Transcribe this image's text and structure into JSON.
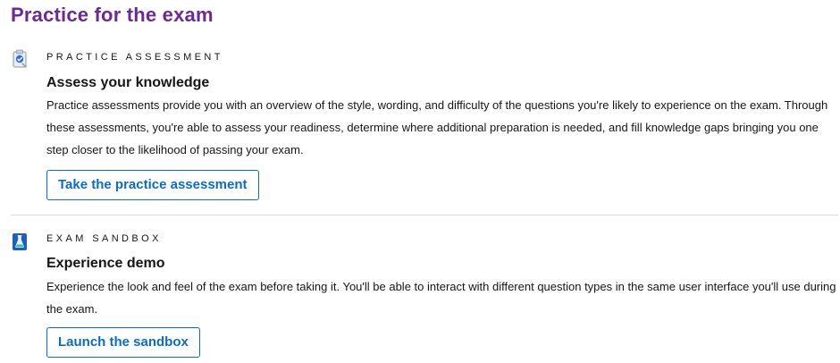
{
  "page": {
    "title": "Practice for the exam"
  },
  "practice_assessment": {
    "eyebrow": "PRACTICE ASSESSMENT",
    "title": "Assess your knowledge",
    "description": "Practice assessments provide you with an overview of the style, wording, and difficulty of the questions you're likely to experience on the exam. Through these assessments, you're able to assess your readiness, determine where additional preparation is needed, and fill knowledge gaps bringing you one step closer to the likelihood of passing your exam.",
    "button_label": "Take the practice assessment",
    "icon": "clipboard-checklist-icon"
  },
  "exam_sandbox": {
    "eyebrow": "EXAM SANDBOX",
    "title": "Experience demo",
    "description": "Experience the look and feel of the exam before taking it. You'll be able to interact with different question types in the same user interface you'll use during the exam.",
    "button_label": "Launch the sandbox",
    "icon": "flask-icon"
  },
  "colors": {
    "title": "#6b2c8f",
    "link": "#0f6cbd",
    "divider": "#dadada",
    "text": "#161616"
  }
}
